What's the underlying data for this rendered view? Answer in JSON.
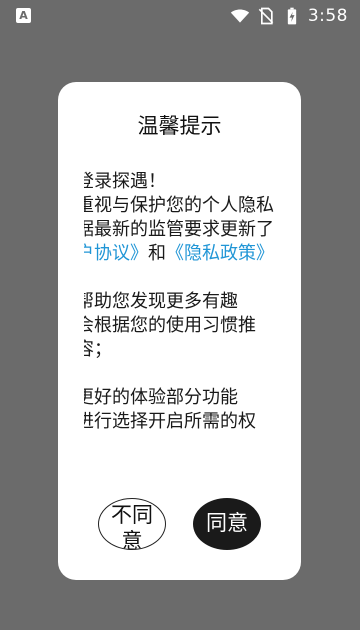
{
  "status_bar": {
    "app_badge": "A",
    "time": "3:58",
    "icons": [
      "notification-app-icon",
      "wifi-icon",
      "no-sim-icon",
      "battery-charging-icon"
    ]
  },
  "dialog": {
    "title": "温馨提示",
    "paragraphs": [
      {
        "lines": [
          {
            "parts": [
              {
                "text": "欢迎登录探遇！",
                "link": false
              }
            ]
          },
          {
            "parts": [
              {
                "text": "我们重视与保护您的个人隐私",
                "link": false
              }
            ]
          },
          {
            "parts": [
              {
                "text": "并根据最新的监管要求更新了",
                "link": false
              }
            ]
          },
          {
            "parts": [
              {
                "text": "《用户协议》",
                "link": true
              },
              {
                "text": "和",
                "link": false
              },
              {
                "text": "《隐私政策》",
                "link": true
              }
            ]
          }
        ]
      },
      {
        "lines": [
          {
            "parts": [
              {
                "text": "为了帮助您发现更多有趣",
                "link": false
              }
            ]
          },
          {
            "parts": [
              {
                "text": "我们会根据您的使用习惯推",
                "link": false
              }
            ]
          },
          {
            "parts": [
              {
                "text": "荐内容；",
                "link": false
              }
            ]
          }
        ]
      },
      {
        "lines": [
          {
            "parts": [
              {
                "text": "为了更好的体验部分功能",
                "link": false
              }
            ]
          },
          {
            "parts": [
              {
                "text": "您可进行选择开启所需的权",
                "link": false
              }
            ]
          }
        ]
      }
    ],
    "disagree_label": "不同意",
    "agree_label": "同意"
  },
  "colors": {
    "overlay": "#6b6b6b",
    "dialog_bg": "#ffffff",
    "link": "#2196d6",
    "agree_bg": "#1a1a1a"
  }
}
